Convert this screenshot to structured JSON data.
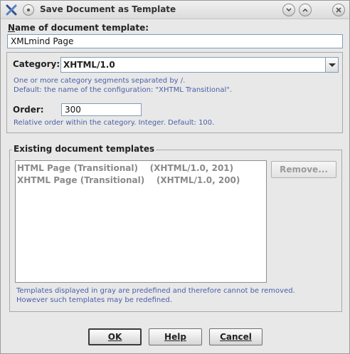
{
  "window": {
    "title": "Save Document as Template",
    "app_icon": "xmlmind-x-icon",
    "menu_icon": "window-menu-icon",
    "controls": [
      "minimize-icon",
      "maximize-icon",
      "close-icon"
    ]
  },
  "name": {
    "label": "Name of document template:",
    "value": "XMLmind Page"
  },
  "category": {
    "label": "Category:",
    "value": "XHTML/1.0",
    "hint_line1": "One or more category segments separated by /.",
    "hint_line2": "Default: the name of the configuration: \"XHTML Transitional\"."
  },
  "order": {
    "label": "Order:",
    "value": "300",
    "hint": "Relative order within the category. Integer. Default: 100."
  },
  "existing": {
    "legend": "Existing document templates",
    "items": [
      {
        "text": "HTML Page (Transitional)    (XHTML/1.0, 201)"
      },
      {
        "text": "XHTML Page (Transitional)    (XHTML/1.0, 200)"
      }
    ],
    "remove_label": "Remove...",
    "note_line1": "Templates displayed in gray are predefined and therefore cannot be removed.",
    "note_line2": "However such templates may be redefined."
  },
  "buttons": {
    "ok": "OK",
    "help": "Help",
    "cancel": "Cancel"
  }
}
